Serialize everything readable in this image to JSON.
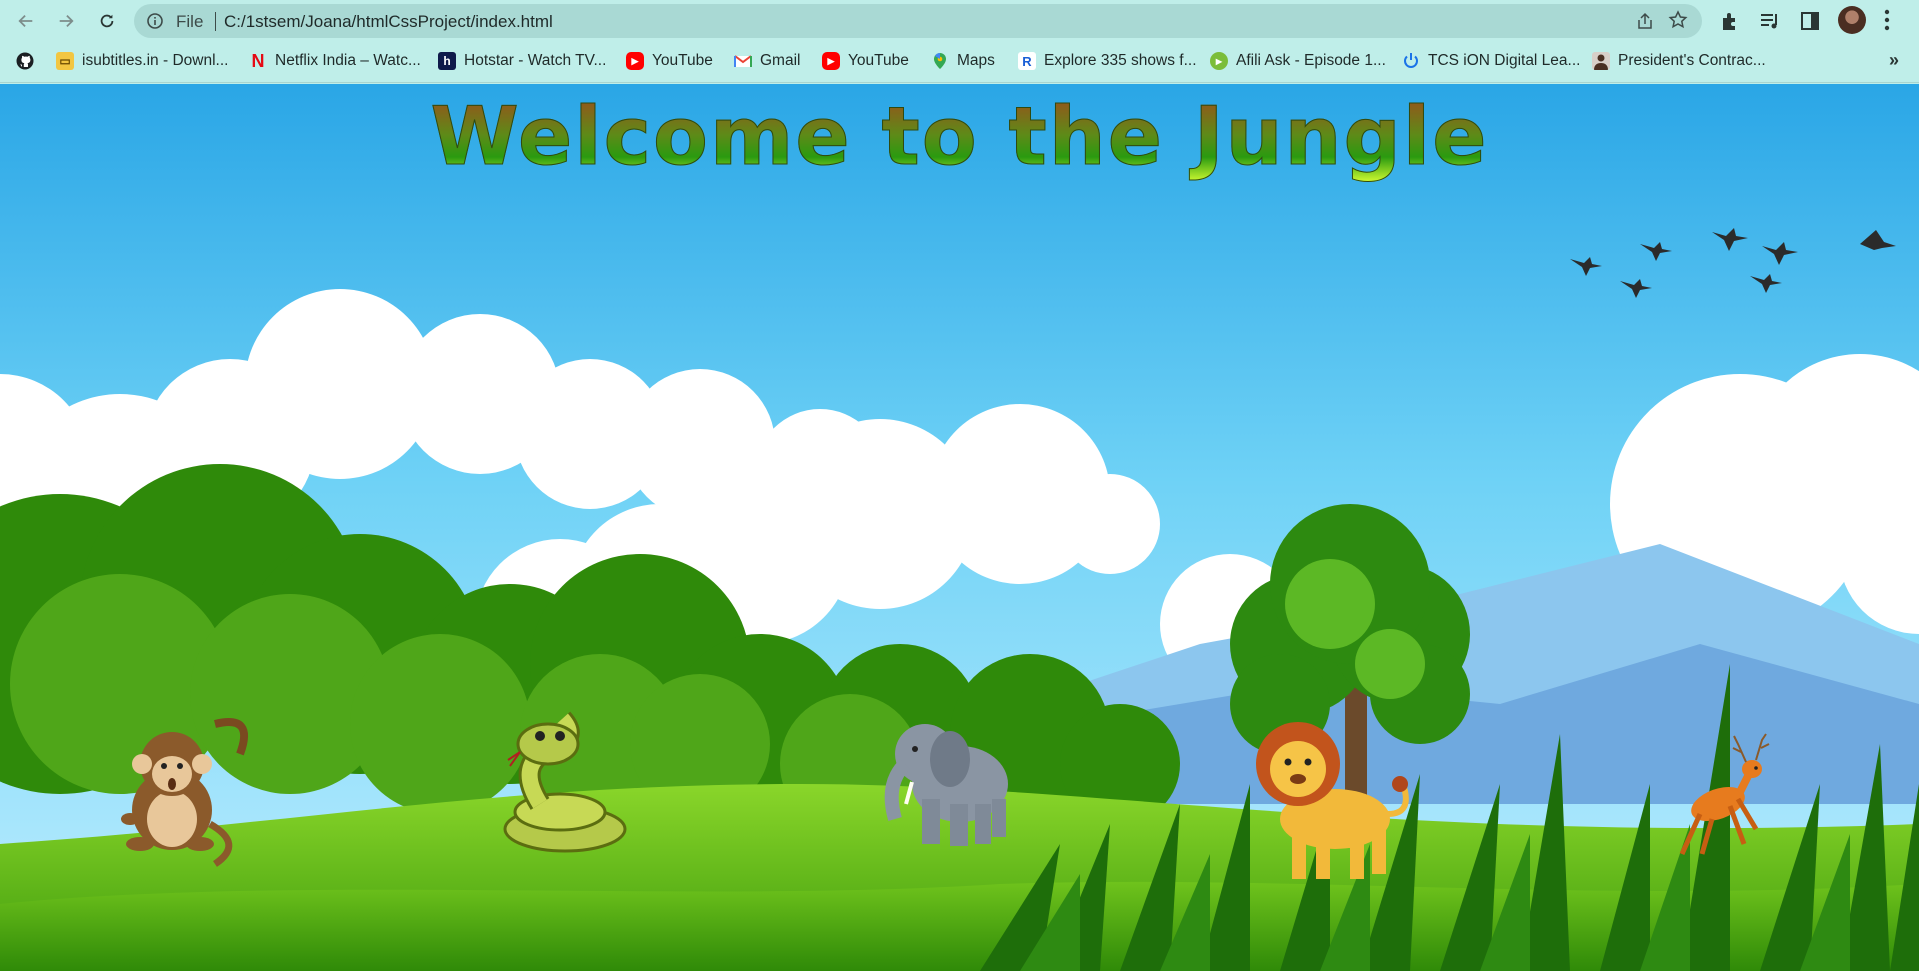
{
  "browser": {
    "scheme_label": "File",
    "url": "C:/1stsem/Joana/htmlCssProject/index.html"
  },
  "bookmarks": [
    {
      "label": "",
      "icon": "github-icon"
    },
    {
      "label": "isubtitles.in - Downl...",
      "icon": "isubtitles-icon"
    },
    {
      "label": "Netflix India – Watc...",
      "icon": "netflix-icon"
    },
    {
      "label": "Hotstar - Watch TV...",
      "icon": "hotstar-icon"
    },
    {
      "label": "YouTube",
      "icon": "youtube-icon"
    },
    {
      "label": "Gmail",
      "icon": "gmail-icon"
    },
    {
      "label": "YouTube",
      "icon": "youtube-icon"
    },
    {
      "label": "Maps",
      "icon": "maps-icon"
    },
    {
      "label": "Explore 335 shows f...",
      "icon": "r-icon"
    },
    {
      "label": "Afili Ask - Episode 1...",
      "icon": "play-icon"
    },
    {
      "label": "TCS iON Digital Lea...",
      "icon": "power-icon"
    },
    {
      "label": "President's Contrac...",
      "icon": "person-icon"
    }
  ],
  "page": {
    "title": "Welcome to the Jungle",
    "animals": [
      "monkey",
      "snake",
      "elephant",
      "lion",
      "deer"
    ]
  },
  "colors": {
    "chrome_bg": "#bfeee9",
    "omnibox_bg": "#a9d9d4",
    "sky_top": "#2aa6e6",
    "grass": "#5cbf12"
  }
}
